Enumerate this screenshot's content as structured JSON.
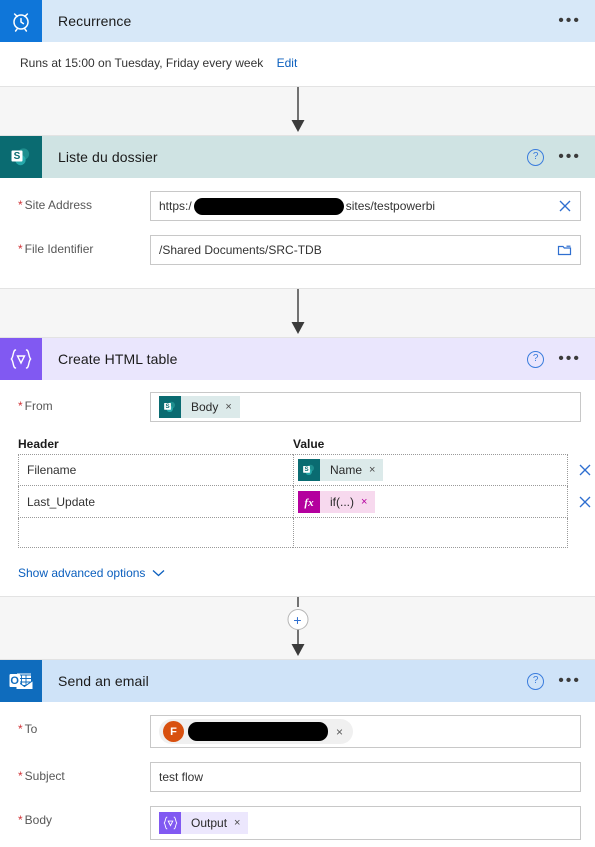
{
  "flow": {
    "steps": [
      {
        "id": "recurrence",
        "title": "Recurrence",
        "icon": "alarm-clock-icon",
        "subtitle": "Runs at 15:00 on Tuesday, Friday every week",
        "edit_label": "Edit"
      },
      {
        "id": "liste-du-dossier",
        "title": "Liste du dossier",
        "icon": "sharepoint-icon",
        "fields": [
          {
            "label": "Site Address",
            "required": true,
            "value_prefix": "https:/",
            "value_suffix": "sites/testpowerbi",
            "redacted": true,
            "trailing_icon": "clear-icon"
          },
          {
            "label": "File Identifier",
            "required": true,
            "value": "/Shared Documents/SRC-TDB",
            "trailing_icon": "folder-picker-icon"
          }
        ]
      },
      {
        "id": "create-html-table",
        "title": "Create HTML table",
        "icon": "data-operation-icon",
        "from_label": "From",
        "from_token": {
          "label": "Body",
          "icon": "sharepoint-icon",
          "remove": "×"
        },
        "table": {
          "header_column_label": "Header",
          "value_column_label": "Value",
          "rows": [
            {
              "header": "Filename",
              "token": {
                "label": "Name",
                "icon": "sharepoint-icon",
                "kind": "sp",
                "remove": "×"
              }
            },
            {
              "header": "Last_Update",
              "token": {
                "label": "if(...)",
                "icon": "function-icon",
                "kind": "fx",
                "remove": "×"
              }
            },
            {
              "header": "",
              "token": null
            }
          ]
        },
        "advanced_options_label": "Show advanced options"
      },
      {
        "id": "send-an-email",
        "title": "Send an email",
        "icon": "outlook-icon",
        "fields": [
          {
            "label": "To",
            "required": true,
            "avatar_initial": "F",
            "redacted": true,
            "remove": "×"
          },
          {
            "label": "Subject",
            "required": true,
            "value": "test flow"
          },
          {
            "label": "Body",
            "required": true,
            "token": {
              "label": "Output",
              "icon": "data-operation-icon",
              "kind": "dt",
              "remove": "×"
            }
          }
        ]
      }
    ],
    "add_step_label": "+",
    "help_label": "?",
    "more_label": "•••"
  },
  "colors": {
    "recurrence_tile": "#0f76d9",
    "recurrence_header": "#d7e8f8",
    "sharepoint_tile": "#0a6b71",
    "sharepoint_header": "#cfe3e3",
    "datatable_tile": "#8159f2",
    "datatable_header": "#eae6fd",
    "outlook_tile": "#0f6cbd",
    "outlook_header": "#cfe3f8",
    "function_token": "#b4009e",
    "avatar": "#d8500f",
    "link": "#0b5fbe",
    "required_asterisk": "#d13438"
  }
}
